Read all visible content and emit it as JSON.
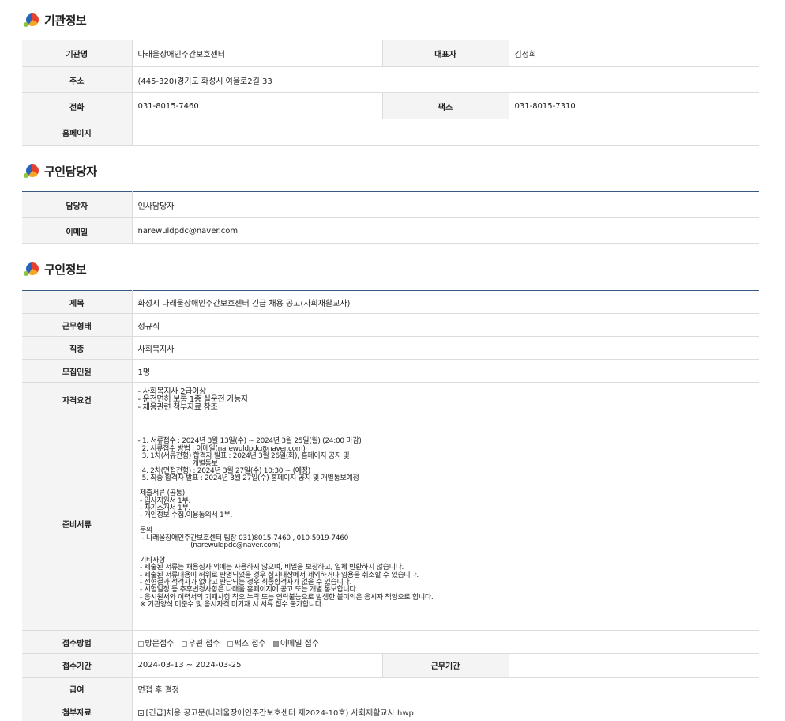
{
  "org_section": {
    "title": "기관정보",
    "rows": [
      {
        "label": "기관명",
        "value": "나래울장애인주간보호센터",
        "label2": "대표자",
        "value2": "김정희"
      },
      {
        "label": "주소",
        "value": "(445-320)경기도 화성시 여울로2길 33"
      },
      {
        "label": "전화",
        "value": "031-8015-7460",
        "label2": "팩스",
        "value2": "031-8015-7310"
      },
      {
        "label": "홈페이지",
        "value": ""
      }
    ]
  },
  "contact_section": {
    "title": "구인담당자",
    "rows": [
      {
        "label": "담당자",
        "value": "인사담당자"
      },
      {
        "label": "이메일",
        "value": "narewuldpdc@naver.com"
      }
    ]
  },
  "job_section": {
    "title": "구인정보",
    "rows": [
      {
        "label": "제목",
        "value": "화성시 나래울장애인주간보호센터 긴급 채용 공고(사회재활교사)"
      },
      {
        "label": "근무형태",
        "value": "정규직"
      },
      {
        "label": "직종",
        "value": "사회복지사"
      },
      {
        "label": "모집인원",
        "value": "1명"
      }
    ],
    "qualification": {
      "label": "자격요건",
      "value": "- 사회복지사 2급이상\n- 운전면허 보통 1종 실운전 가능자\n- 채용관련 첨부자료 참조"
    },
    "documents": {
      "label": "준비서류",
      "value": "- 1. 서류접수 : 2024년 3월 13일(수) ~ 2024년 3월 25일(월) (24:00 마감)\n  2. 서류접수 방법 : 이메일(narewuldpdc@naver.com)\n  3. 1차(서류전형) 합격자 발표 : 2024년 3월 26일(화), 홈페이지 공지 및\n                           개별통보\n  4. 2차(면접전형) : 2024년 3월 27일(수) 10:30 ~ (예정)\n  5. 최종 합격자 발표 : 2024년 3월 27일(수) 홈페이지 공지 및 개별통보예정\n\n 제출서류 (공통)\n - 입사지원서 1부.\n - 자기소개서 1부.\n - 개인정보 수집.이용동의서 1부.\n\n 문의\n  - 나래울장애인주간보호센터 팀장 031)8015-7460 , 010-5919-7460\n                          (narewuldpdc@naver.com)\n\n 기타사항\n - 제출된 서류는 채용심사 외에는 사용하지 않으며, 비밀을 보장하고, 일체 반환하지 않습니다.\n - 제출된 서류내용이 허위로 판명되었을 경우 심사대상에서 제외하거나 임용을 취소할 수 있습니다.\n - 전형결과 적격자가 없다고 판단되는 경우 최종합격자가 없을 수 있습니다.\n - 시험일정 등 추후변경사항은 나래울 홈페이지에 공고 또는 개별 통보합니다.\n - 응시원서와 이력서의 기재사항 착오.누락 또는 연락불능으로 발생한 불이익은 응시자 책임으로 합니다.\n ※ 기관양식 미준수 및 응시자격 미기재 시 서류 접수 불가합니다."
    },
    "receipt_method": {
      "label": "접수방법",
      "options": [
        {
          "text": "방문접수",
          "checked": false
        },
        {
          "text": "우편 접수",
          "checked": false
        },
        {
          "text": "팩스 접수",
          "checked": false
        },
        {
          "text": "이메일 접수",
          "checked": true
        }
      ]
    },
    "receipt_period": {
      "label": "접수기간",
      "value": "2024-03-13 ~ 2024-03-25",
      "label2": "근무기간",
      "value2": ""
    },
    "salary": {
      "label": "급여",
      "value": "면접 후 결정"
    },
    "attachment": {
      "label": "첨부자료",
      "value": "[긴급]채용 공고문(나래울장애인주간보호센터 제2024-10호) 사회재활교사.hwp"
    }
  }
}
